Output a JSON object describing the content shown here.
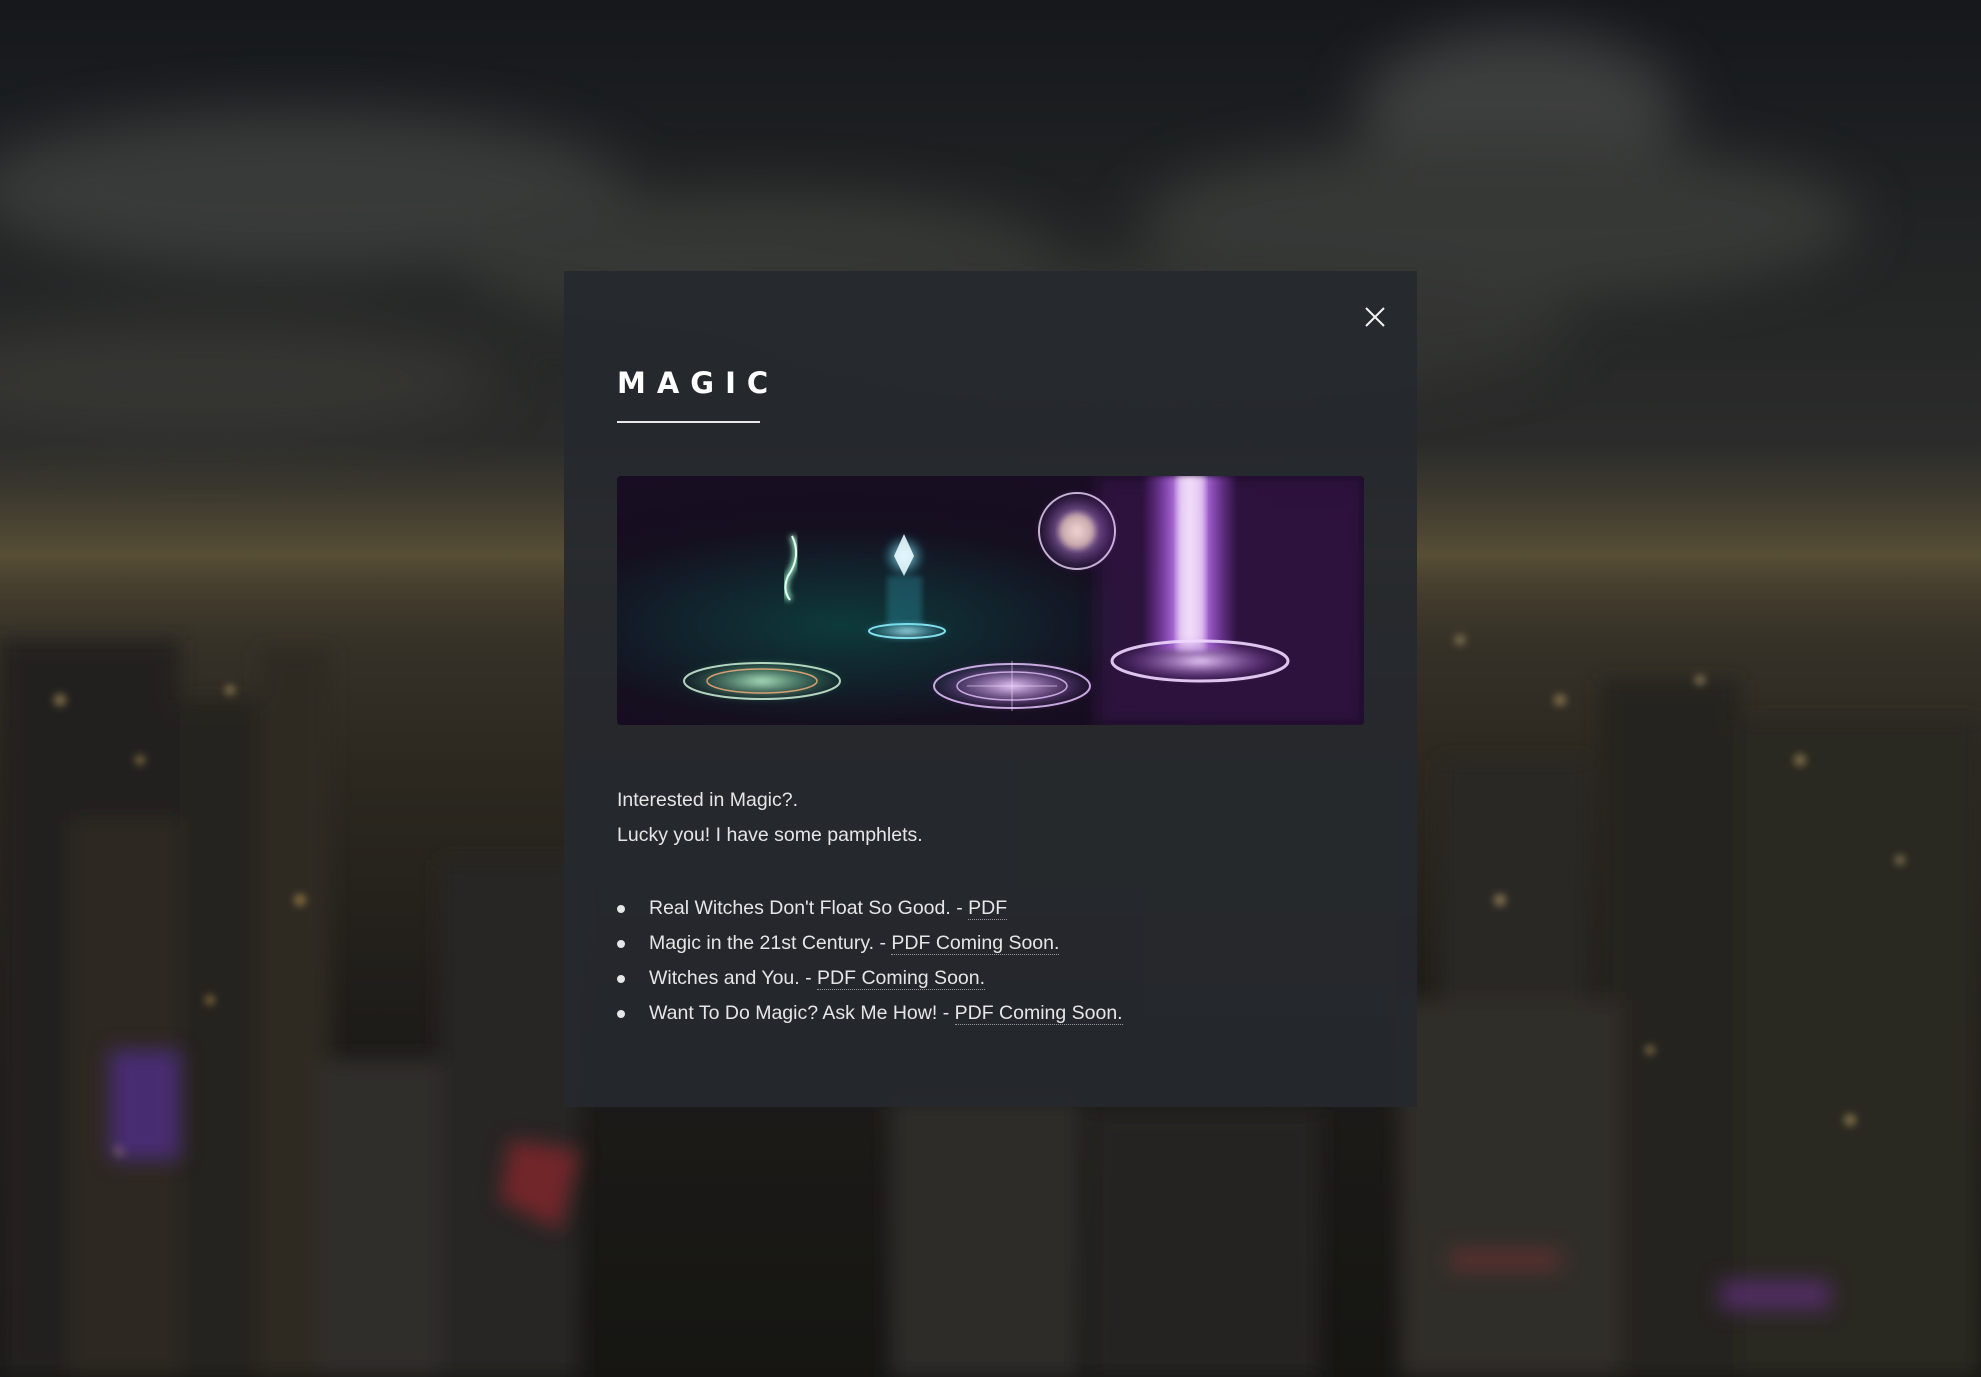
{
  "modal": {
    "title": "MAGIC",
    "close_icon": "close-icon",
    "banner_image": "magic-circles-illustration",
    "intro_lines": [
      "Interested in Magic?.",
      "Lucky you! I have some pamphlets."
    ],
    "pamphlets": [
      {
        "text": "Real Witches Don't Float So Good. - ",
        "link": "PDF"
      },
      {
        "text": "Magic in the 21st Century. - ",
        "link": "PDF Coming Soon."
      },
      {
        "text": "Witches and You. - ",
        "link": "PDF Coming Soon."
      },
      {
        "text": "Want To Do Magic? Ask Me How! - ",
        "link": "PDF Coming Soon."
      }
    ]
  },
  "background": {
    "image": "blurred-night-city-skyline"
  },
  "colors": {
    "modal_bg": "#26292e",
    "text": "#e6e6e6",
    "title": "#ffffff"
  }
}
